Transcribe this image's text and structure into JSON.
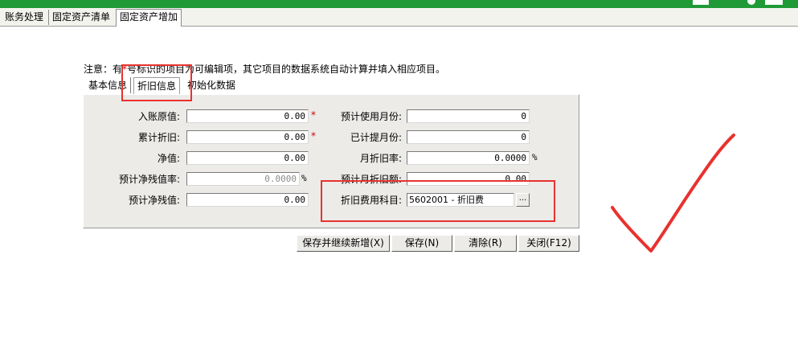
{
  "app_tabs": [
    "账务处理",
    "固定资产清单",
    "固定资产增加"
  ],
  "notice": {
    "prefix": "注意：有",
    "star": "*",
    "suffix": "号标识的项目为可编辑项，其它项目的数据系统自动计算并填入相应项目。"
  },
  "form_tabs": [
    "基本信息",
    "折旧信息",
    "初始化数据"
  ],
  "left_fields": [
    {
      "label": "入账原值:",
      "value": "0.00",
      "required": true
    },
    {
      "label": "累计折旧:",
      "value": "0.00",
      "required": true
    },
    {
      "label": "净值:",
      "value": "0.00"
    },
    {
      "label": "预计净残值率:",
      "value": "0.0000",
      "unit": "%",
      "readonly": true
    },
    {
      "label": "预计净残值:",
      "value": "0.00"
    }
  ],
  "right_fields": [
    {
      "label": "预计使用月份:",
      "value": "0"
    },
    {
      "label": "已计提月份:",
      "value": "0"
    },
    {
      "label": "月折旧率:",
      "value": "0.0000",
      "unit": "%"
    },
    {
      "label": "预计月折旧额:",
      "value": "0.00"
    },
    {
      "label": "折旧费用科目:",
      "value": "5602001 - 折旧费",
      "button": "..."
    }
  ],
  "buttons": [
    "保存并继续新增(X)",
    "保存(N)",
    "清除(R)",
    "关闭(F12)"
  ],
  "colors": {
    "title_bar": "#1f9a37",
    "annotation": "#e8322e",
    "required_mark": "#d00000"
  },
  "annotations": [
    "red-box-depreciation-tab",
    "red-box-expense-account",
    "red-checkmark"
  ]
}
